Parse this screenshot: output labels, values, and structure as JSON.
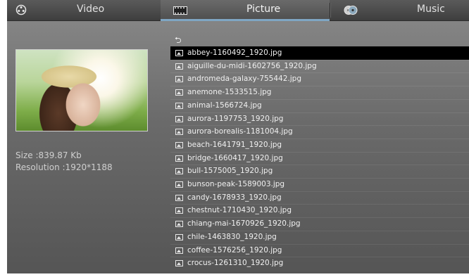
{
  "tabs": {
    "video": {
      "label": "Video",
      "icon": "film-reel-icon"
    },
    "picture": {
      "label": "Picture",
      "icon": "filmstrip-icon",
      "selected": true
    },
    "music": {
      "label": "Music",
      "icon": "music-cd-icon"
    }
  },
  "info": {
    "size": "Size :839.87 Kb",
    "resolution": "Resolution :1920*1188"
  },
  "list": {
    "back_glyph": "⮌",
    "selected_index": 0,
    "files": [
      "abbey-1160492_1920.jpg",
      "aiguille-du-midi-1602756_1920.jpg",
      "andromeda-galaxy-755442.jpg",
      "anemone-1533515.jpg",
      "animal-1566724.jpg",
      "aurora-1197753_1920.jpg",
      "aurora-borealis-1181004.jpg",
      "beach-1641791_1920.jpg",
      "bridge-1660417_1920.jpg",
      "bull-1575005_1920.jpg",
      "bunson-peak-1589003.jpg",
      "candy-1678933_1920.jpg",
      "chestnut-1710430_1920.jpg",
      "chiang-mai-1670926_1920.jpg",
      "chile-1463830_1920.jpg",
      "coffee-1576256_1920.jpg",
      "crocus-1261310_1920.jpg"
    ]
  }
}
